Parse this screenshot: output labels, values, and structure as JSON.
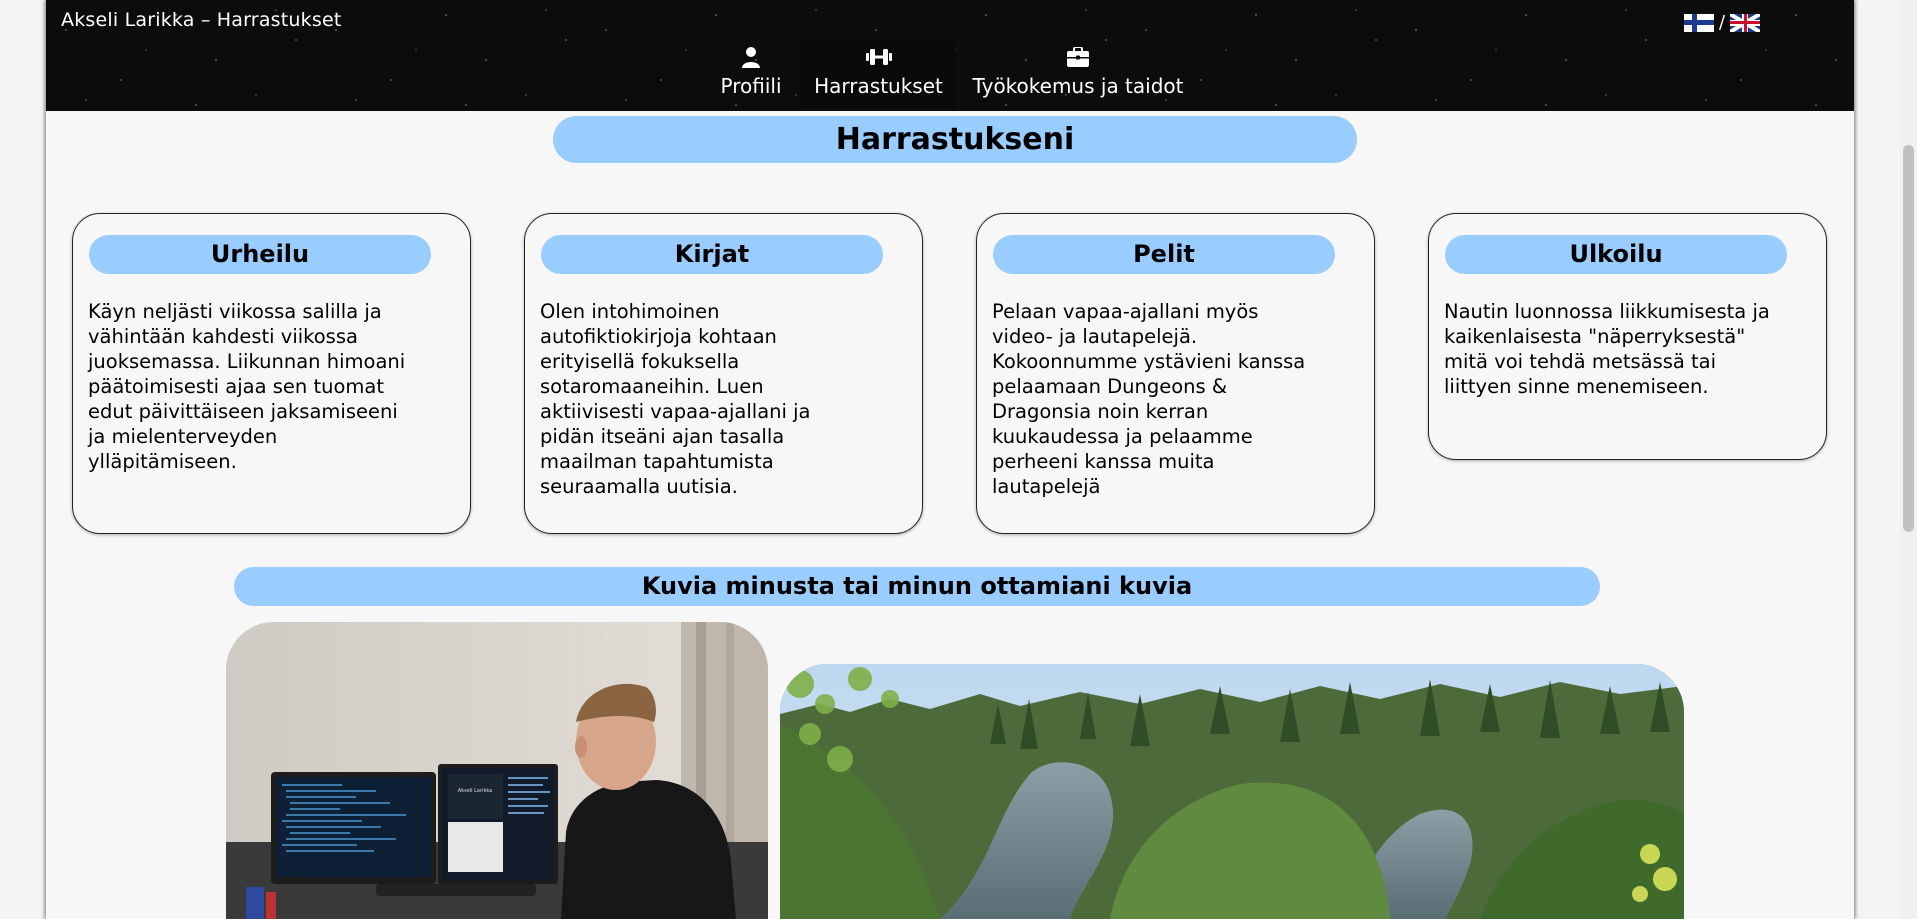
{
  "header": {
    "site_title": "Akseli Larikka – Harrastukset",
    "language_separator": "/",
    "languages": [
      {
        "name": "Finnish",
        "icon": "finland-flag-icon"
      },
      {
        "name": "English",
        "icon": "uk-flag-icon"
      }
    ]
  },
  "nav": {
    "items": [
      {
        "label": "Profiili",
        "icon": "user-icon",
        "active": false
      },
      {
        "label": "Harrastukset",
        "icon": "dumbbell-icon",
        "active": true
      },
      {
        "label": "Työkokemus ja taidot",
        "icon": "briefcase-icon",
        "active": false
      }
    ]
  },
  "main": {
    "heading": "Harrastukseni",
    "cards": [
      {
        "title": "Urheilu",
        "text": "Käyn neljästi viikossa salilla ja vähintään kahdesti viikossa juoksemassa. Liikunnan himoani päätoimisesti ajaa sen tuomat edut päivittäiseen jaksamiseeni ja mielenterveyden ylläpitämiseen."
      },
      {
        "title": "Kirjat",
        "text": "Olen intohimoinen autofiktiokirjoja kohtaan erityisellä fokuksella sotaromaaneihin. Luen aktiivisesti vapaa-ajallani ja pidän itseäni ajan tasalla maailman tapahtumista seuraamalla uutisia."
      },
      {
        "title": "Pelit",
        "text": "Pelaan vapaa-ajallani myös video- ja lautapelejä. Kokoonnumme ystävieni kanssa pelaamaan Dungeons & Dragonsia noin kerran kuukaudessa ja pelaamme perheeni kanssa muita lautapelejä"
      },
      {
        "title": "Ulkoilu",
        "text": "Nautin luonnossa liikkumisesta ja kaikenlaisesta \"näperryksestä\" mitä voi tehdä metsässä tai liittyen sinne menemiseen."
      }
    ],
    "photos_heading": "Kuvia minusta tai minun ottamiani kuvia",
    "screen_text": "Akseli Larikka"
  },
  "colors": {
    "accent": "#99ccff",
    "header_bg": "#0c0c0c",
    "page_bg": "#f7f7f7"
  }
}
